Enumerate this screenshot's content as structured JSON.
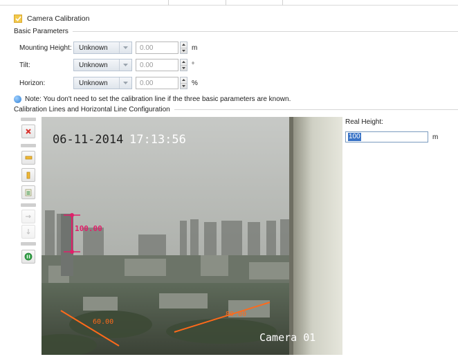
{
  "header": {
    "checkbox_checked": true,
    "title": "Camera Calibration"
  },
  "basic_parameters": {
    "section_title": "Basic Parameters",
    "rows": [
      {
        "label": "Mounting Height:",
        "mode": "Unknown",
        "value": "0.00",
        "unit": "m"
      },
      {
        "label": "Tilt:",
        "mode": "Unknown",
        "value": "0.00",
        "unit": "°"
      },
      {
        "label": "Horizon:",
        "mode": "Unknown",
        "value": "0.00",
        "unit": "%"
      }
    ]
  },
  "note": {
    "text": "Note: You don't need to set the calibration line if the three basic parameters are known."
  },
  "calibration": {
    "section_title": "Calibration Lines and Horizontal Line Configuration",
    "toolbar_icons": [
      "delete-icon",
      "horizontal-line-icon",
      "vertical-line-icon",
      "calibration-table-icon",
      "move-right-icon",
      "move-down-icon",
      "verify-icon"
    ]
  },
  "video": {
    "timestamp_date": "06-11-2014",
    "timestamp_time": "17:13:56",
    "camera_name": "Camera 01",
    "vertical_line_label": "100.00",
    "line_label_left": "60.00",
    "line_label_right": "80.00",
    "line_color": "#ff6a1a",
    "vertical_line_color": "#e0206a"
  },
  "real_height": {
    "label": "Real Height:",
    "value": "100",
    "unit": "m"
  }
}
